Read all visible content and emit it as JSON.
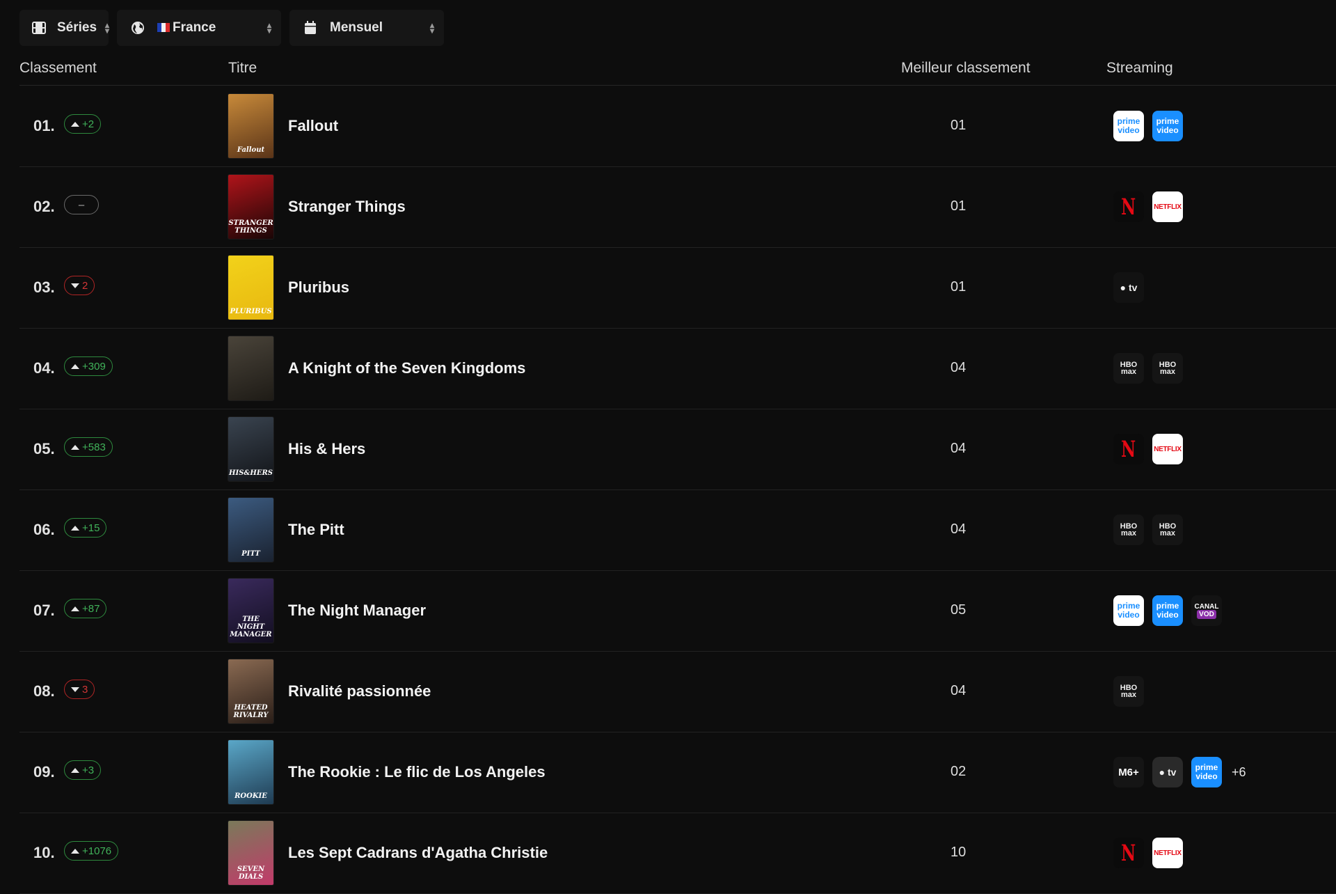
{
  "filters": {
    "category": "Séries",
    "country": "France",
    "period": "Mensuel"
  },
  "columns": {
    "rank": "Classement",
    "title": "Titre",
    "best_rank": "Meilleur classement",
    "streaming": "Streaming"
  },
  "rows": [
    {
      "rank": "01.",
      "delta": "+2",
      "trend": "up",
      "title": "Fallout",
      "best": "01",
      "poster_colors": [
        "#c88a3a",
        "#5a3418"
      ],
      "poster_text": "Fallout",
      "services": [
        "prime",
        "prime-ch"
      ]
    },
    {
      "rank": "02.",
      "delta": "–",
      "trend": "same",
      "title": "Stranger Things",
      "best": "01",
      "poster_colors": [
        "#b0141a",
        "#1a0606"
      ],
      "poster_text": "STRANGER THINGS",
      "services": [
        "netflix",
        "netflix-ads"
      ]
    },
    {
      "rank": "03.",
      "delta": "2",
      "trend": "down",
      "title": "Pluribus",
      "best": "01",
      "poster_colors": [
        "#f2d21a",
        "#e8b810"
      ],
      "poster_text": "PLURIBUS",
      "services": [
        "appletv"
      ]
    },
    {
      "rank": "04.",
      "delta": "+309",
      "trend": "up",
      "title": "A Knight of the Seven Kingdoms",
      "best": "04",
      "poster_colors": [
        "#4a443a",
        "#1e1b16"
      ],
      "poster_text": "",
      "services": [
        "hbo",
        "hbo-ch"
      ]
    },
    {
      "rank": "05.",
      "delta": "+583",
      "trend": "up",
      "title": "His & Hers",
      "best": "04",
      "poster_colors": [
        "#3a4450",
        "#121418"
      ],
      "poster_text": "HIS&HERS",
      "services": [
        "netflix",
        "netflix-ads"
      ]
    },
    {
      "rank": "06.",
      "delta": "+15",
      "trend": "up",
      "title": "The Pitt",
      "best": "04",
      "poster_colors": [
        "#3c5b80",
        "#1a2230"
      ],
      "poster_text": "PITT",
      "services": [
        "hbo",
        "hbo-ch"
      ]
    },
    {
      "rank": "07.",
      "delta": "+87",
      "trend": "up",
      "title": "The Night Manager",
      "best": "05",
      "poster_colors": [
        "#3a2a5c",
        "#120e20"
      ],
      "poster_text": "THE NIGHT MANAGER",
      "services": [
        "prime",
        "prime-ch",
        "canal"
      ]
    },
    {
      "rank": "08.",
      "delta": "3",
      "trend": "down",
      "title": "Rivalité passionnée",
      "best": "04",
      "poster_colors": [
        "#8a6a52",
        "#2a1e18"
      ],
      "poster_text": "HEATED RIVALRY",
      "services": [
        "hbo"
      ]
    },
    {
      "rank": "09.",
      "delta": "+3",
      "trend": "up",
      "title": "The Rookie : Le flic de Los Angeles",
      "best": "02",
      "poster_colors": [
        "#5aa7c8",
        "#1f3b52"
      ],
      "poster_text": "ROOKIE",
      "services": [
        "m6",
        "appletv-ch",
        "prime-ch"
      ],
      "more": "+6"
    },
    {
      "rank": "10.",
      "delta": "+1076",
      "trend": "up",
      "title": "Les Sept Cadrans d'Agatha Christie",
      "best": "10",
      "poster_colors": [
        "#7a7a5a",
        "#c23a6a"
      ],
      "poster_text": "SEVEN DIALS",
      "services": [
        "netflix",
        "netflix-ads"
      ]
    }
  ],
  "service_labels": {
    "prime": [
      "prime",
      "video"
    ],
    "prime-ch": [
      "prime",
      "video"
    ],
    "netflix": "N",
    "netflix-ads": "NETFLIX",
    "hbo": [
      "HBO",
      "max"
    ],
    "hbo-ch": [
      "HBO",
      "max"
    ],
    "appletv": "tv",
    "appletv-ch": "tv",
    "canal": [
      "CANAL",
      "VOD"
    ],
    "m6": "M6+"
  },
  "colors": {
    "up": "#41b35a",
    "down": "#d23636",
    "prime_blue": "#1a8fff",
    "netflix_red": "#e50914"
  }
}
